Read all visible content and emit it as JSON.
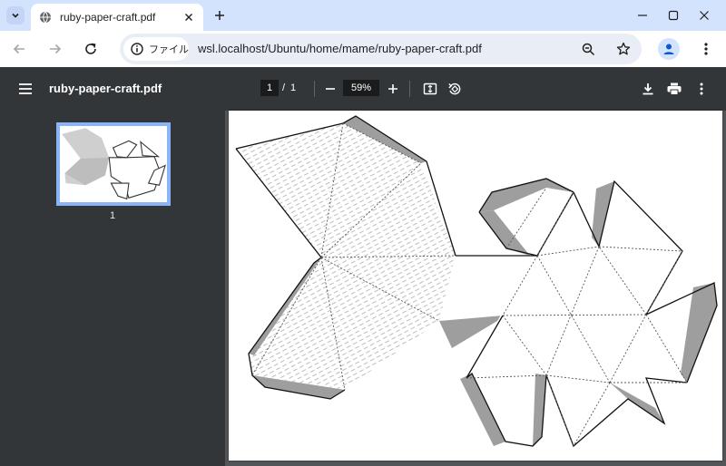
{
  "tab": {
    "title": "ruby-paper-craft.pdf",
    "favicon": "globe-icon"
  },
  "window_controls": [
    "minimize-icon",
    "maximize-icon",
    "close-icon"
  ],
  "toolbar": {
    "site_chip_label": "ファイル",
    "url": "wsl.localhost/Ubuntu/home/mame/ruby-paper-craft.pdf"
  },
  "pdf": {
    "title": "ruby-paper-craft.pdf",
    "page_current": "1",
    "page_separator": "/",
    "page_total": "1",
    "zoom": "59%"
  },
  "sidebar": {
    "thumbnail_label": "1"
  },
  "colors": {
    "tabstrip": "#d3e3fd",
    "pdf_toolbar": "#323639",
    "viewer_bg": "#525659",
    "thumb_border": "#8ab4f8",
    "shade": "#9e9e9e"
  }
}
